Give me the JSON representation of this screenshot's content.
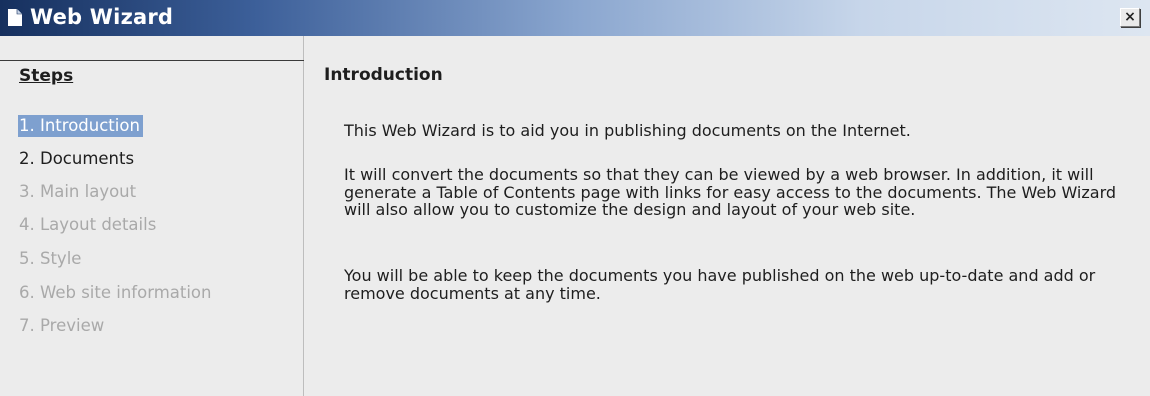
{
  "window": {
    "title": "Web Wizard",
    "close_label": "×"
  },
  "steps": {
    "heading": "Steps",
    "items": [
      {
        "label": "1. Introduction",
        "state": "selected"
      },
      {
        "label": "2. Documents",
        "state": "enabled"
      },
      {
        "label": "3. Main layout",
        "state": "disabled"
      },
      {
        "label": "4. Layout details",
        "state": "disabled"
      },
      {
        "label": "5. Style",
        "state": "disabled"
      },
      {
        "label": "6. Web site information",
        "state": "disabled"
      },
      {
        "label": "7. Preview",
        "state": "disabled"
      }
    ]
  },
  "content": {
    "title": "Introduction",
    "paragraphs": [
      "This Web Wizard is to aid you in publishing documents on the Internet.",
      "It will convert the documents so that they can be viewed by a web browser. In addition, it will generate a Table of Contents page with links for easy access to the documents. The Web Wizard will also allow you to customize the design and layout of your web site.",
      "You will be able to keep the documents you have published on the web up-to-date and add or remove documents at any time."
    ]
  },
  "colors": {
    "titlebar_dark": "#16305e",
    "titlebar_light": "#dde6f1",
    "selection": "#7ea0cf",
    "disabled_text": "#a9a9a9",
    "panel_bg": "#ececec"
  },
  "icons": {
    "title_icon": "document-icon",
    "close_icon": "close-icon"
  }
}
